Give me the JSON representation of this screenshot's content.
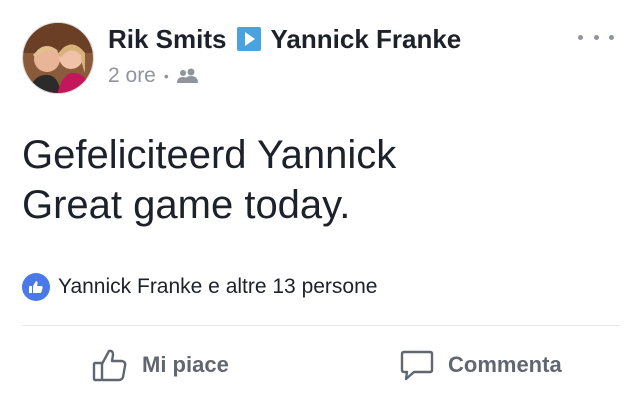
{
  "post": {
    "author": "Rik Smits",
    "recipient": "Yannick Franke",
    "time": "2 ore",
    "separator": "•",
    "audience_icon": "friends-icon",
    "text_lines": [
      "Gefeliciteerd Yannick",
      "Great game today."
    ]
  },
  "reactions": {
    "summary": "Yannick Franke e altre 13 persone",
    "icon": "like-badge-icon"
  },
  "actions": {
    "like_label": "Mi piace",
    "comment_label": "Commenta"
  },
  "colors": {
    "accent": "#4a79e8",
    "secondary_text": "#90949c",
    "action_text": "#606770",
    "primary_text": "#1d2129"
  }
}
